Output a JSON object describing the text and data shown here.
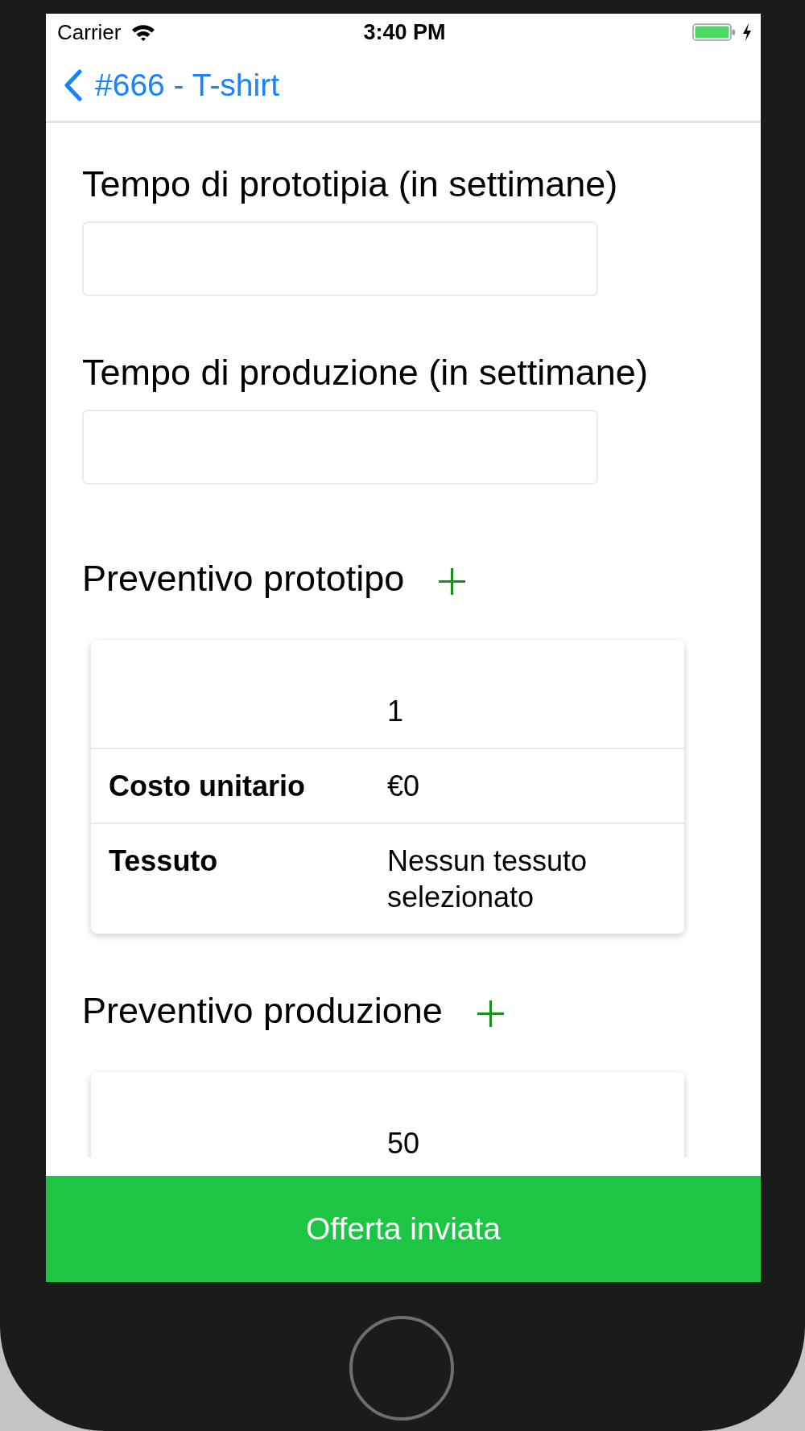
{
  "status_bar": {
    "carrier": "Carrier",
    "time": "3:40 PM",
    "charging": true
  },
  "nav_bar": {
    "back_title": "#666 - T-shirt"
  },
  "fields": [
    {
      "label": "Tempo di prototipia (in settimane)"
    },
    {
      "label": "Tempo di produzione (in settimane)"
    }
  ],
  "sections": [
    {
      "title": "Preventivo prototipo",
      "rows": [
        {
          "value": "1"
        },
        {
          "label": "Costo unitario",
          "value": "€0"
        },
        {
          "label": "Tessuto",
          "value": "Nessun tessuto selezionato"
        }
      ]
    },
    {
      "title": "Preventivo produzione",
      "rows": [
        {
          "value": "50"
        }
      ]
    }
  ],
  "footer_button": {
    "label": "Offerta inviata"
  }
}
